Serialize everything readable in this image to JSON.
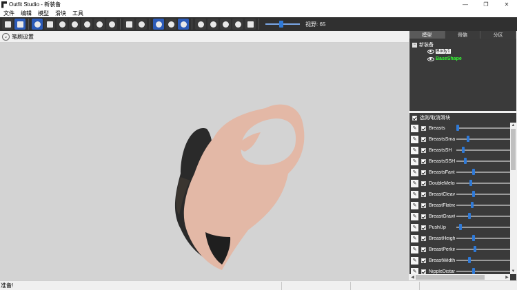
{
  "window": {
    "title": "Outfit Studio - 新装备",
    "minimize": "—",
    "maximize": "❐",
    "close": "✕"
  },
  "menu": [
    "文件",
    "编辑",
    "模型",
    "滑块",
    "工具"
  ],
  "toolbar": {
    "fov_label": "视野: 65",
    "fov_value": 65
  },
  "subbar": {
    "label": "笔刷设置",
    "button": "⌄"
  },
  "right_panel": {
    "tabs": [
      "模型",
      "骨骼",
      "分区"
    ],
    "active_tab": "模型",
    "tree": {
      "root": "新装备",
      "expander": "−",
      "items": [
        "Body1",
        "BaseShape"
      ]
    },
    "slider_header": "选则/取消滑块",
    "sliders": [
      {
        "name": "Breasts",
        "value": 0
      },
      {
        "name": "BreastsSmall",
        "value": 0.2
      },
      {
        "name": "BreastsSH",
        "value": 0.1
      },
      {
        "name": "BreastsSSH",
        "value": 0.15
      },
      {
        "name": "BreastsFantasy",
        "value": 0.3
      },
      {
        "name": "DoubleMelon",
        "value": 0.25
      },
      {
        "name": "BreastCleavage",
        "value": 0.3
      },
      {
        "name": "BreastFlatness",
        "value": 0.27
      },
      {
        "name": "BreastGravity",
        "value": 0.22
      },
      {
        "name": "PushUp",
        "value": 0.05
      },
      {
        "name": "BreastHeight",
        "value": 0.3
      },
      {
        "name": "BreastPerkiness",
        "value": 0.33
      },
      {
        "name": "BreastWidth",
        "value": 0.23
      },
      {
        "name": "NippleDistance",
        "value": 0.3
      }
    ]
  },
  "status": {
    "text": "准备!"
  },
  "colors": {
    "accent": "#2f7ad8",
    "toolbar_bg": "#303030",
    "viewport_bg": "#d3d3d3",
    "skin": "#e3b8a6",
    "outfit": "#2a2a2a"
  }
}
